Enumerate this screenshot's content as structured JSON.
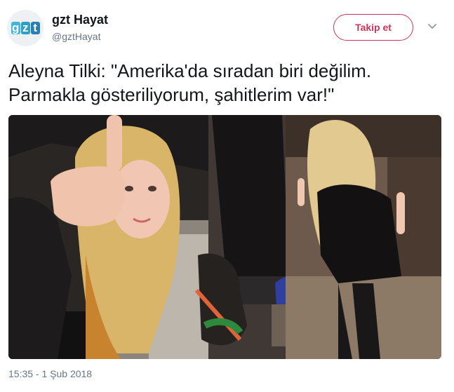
{
  "author": {
    "display_name": "gzt Hayat",
    "screen_name": "@gztHayat",
    "avatar_logo": [
      "g",
      "z",
      "t"
    ],
    "avatar_colors": [
      "#3fb6d6",
      "#2f9fc3",
      "#2a7fb0"
    ]
  },
  "follow_button": {
    "label": "Takip et",
    "color": "#c5365a"
  },
  "menu_icon": "chevron-down-icon",
  "tweet": {
    "text_line_1": "Aleyna Tilki: \"Amerika'da sıradan biri değilim.",
    "text_line_2": "Parmakla gösteriliyorum, şahitlerim var!\"",
    "timestamp": "15:35 - 1 Şub 2018"
  },
  "photo": {
    "description_panels": [
      "left-portrait",
      "center-shoes",
      "right-full-body"
    ]
  }
}
